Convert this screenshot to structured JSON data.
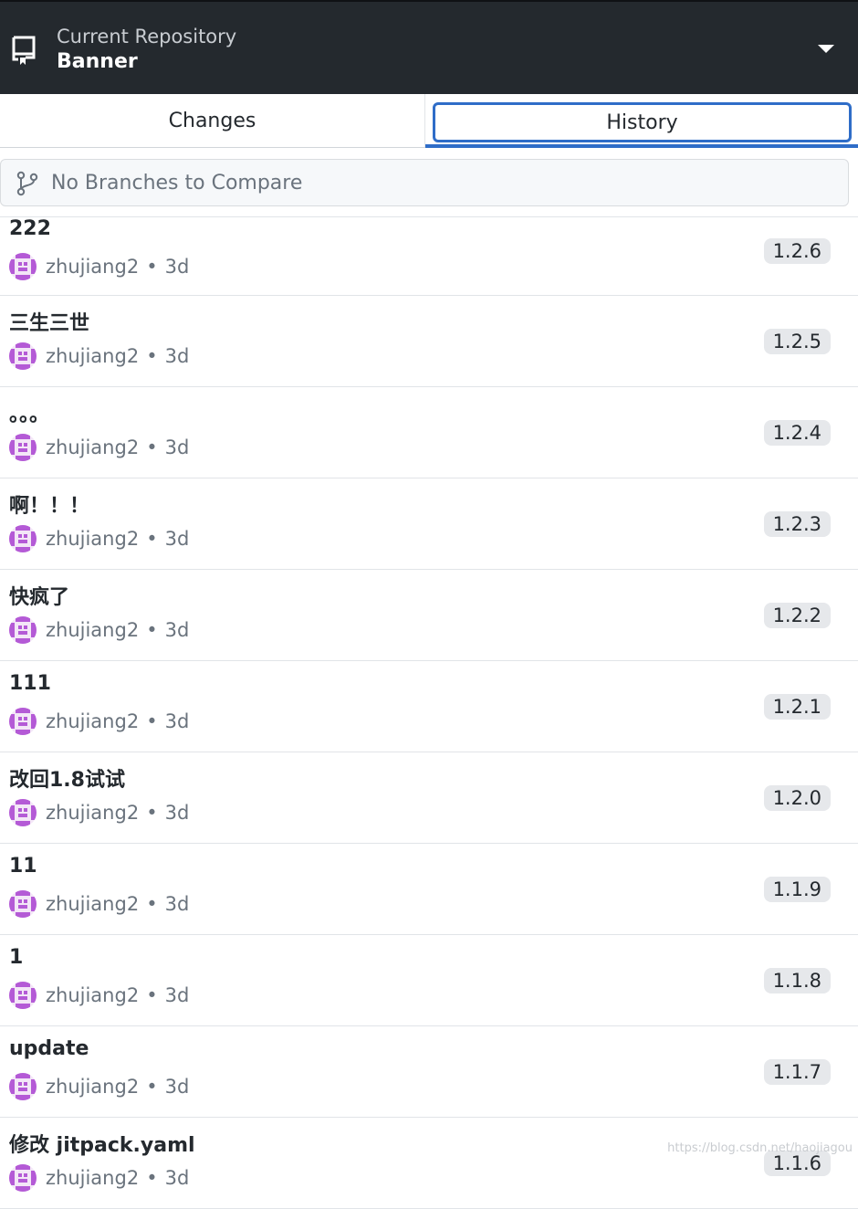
{
  "header": {
    "label": "Current Repository",
    "repo_name": "Banner",
    "icon": "repo-icon",
    "dropdown_icon": "caret-down-icon"
  },
  "tabs": {
    "changes": "Changes",
    "history": "History",
    "active": "History"
  },
  "compare": {
    "placeholder": "No Branches to Compare",
    "icon": "git-branch-icon"
  },
  "commits": [
    {
      "summary": "222",
      "author": "zhujiang2",
      "time": "3d",
      "tag": "1.2.6"
    },
    {
      "summary": "三生三世",
      "author": "zhujiang2",
      "time": "3d",
      "tag": "1.2.5"
    },
    {
      "summary": "。。。",
      "author": "zhujiang2",
      "time": "3d",
      "tag": "1.2.4"
    },
    {
      "summary": "啊！！！",
      "author": "zhujiang2",
      "time": "3d",
      "tag": "1.2.3"
    },
    {
      "summary": "快疯了",
      "author": "zhujiang2",
      "time": "3d",
      "tag": "1.2.2"
    },
    {
      "summary": "111",
      "author": "zhujiang2",
      "time": "3d",
      "tag": "1.2.1"
    },
    {
      "summary": "改回1.8试试",
      "author": "zhujiang2",
      "time": "3d",
      "tag": "1.2.0"
    },
    {
      "summary": "11",
      "author": "zhujiang2",
      "time": "3d",
      "tag": "1.1.9"
    },
    {
      "summary": "1",
      "author": "zhujiang2",
      "time": "3d",
      "tag": "1.1.8"
    },
    {
      "summary": "update",
      "author": "zhujiang2",
      "time": "3d",
      "tag": "1.1.7"
    },
    {
      "summary": "修改 jitpack.yaml",
      "author": "zhujiang2",
      "time": "3d",
      "tag": "1.1.6"
    }
  ],
  "separator": "•",
  "watermark": "https://blog.csdn.net/haojiagou",
  "colors": {
    "header_bg": "#24292e",
    "accent": "#2f6dc8",
    "tag_bg": "#e6e8eb",
    "avatar": "#b45ad6"
  }
}
